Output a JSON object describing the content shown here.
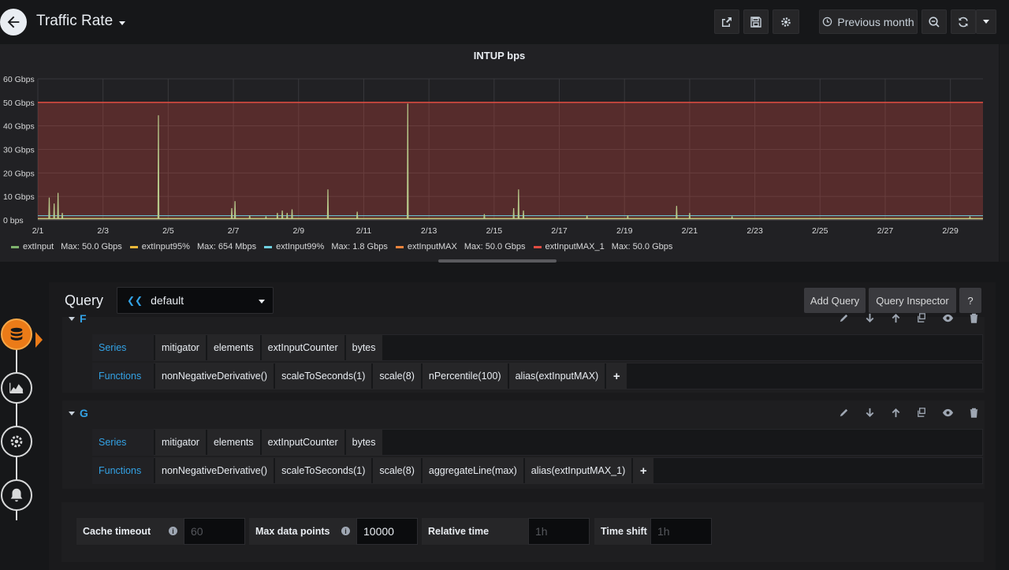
{
  "header": {
    "title": "Traffic Rate",
    "time_range_label": "Previous month"
  },
  "panel": {
    "title": "INTUP bps",
    "legend": [
      {
        "name": "extInput",
        "max": "Max: 50.0 Gbps",
        "color": "#7eb26d"
      },
      {
        "name": "extInput95%",
        "max": "Max: 654 Mbps",
        "color": "#eab839"
      },
      {
        "name": "extInput99%",
        "max": "Max: 1.8 Gbps",
        "color": "#6ed0e0"
      },
      {
        "name": "extInputMAX",
        "max": "Max: 50.0 Gbps",
        "color": "#ef843c"
      },
      {
        "name": "extInputMAX_1",
        "max": "Max: 50.0 Gbps",
        "color": "#e24d42"
      }
    ]
  },
  "chart_data": {
    "type": "line",
    "title": "INTUP bps",
    "y_ticks": [
      "60 Gbps",
      "50 Gbps",
      "40 Gbps",
      "30 Gbps",
      "20 Gbps",
      "10 Gbps",
      "0 bps"
    ],
    "x_ticks": [
      "2/1",
      "2/3",
      "2/5",
      "2/7",
      "2/9",
      "2/11",
      "2/13",
      "2/15",
      "2/17",
      "2/19",
      "2/21",
      "2/23",
      "2/25",
      "2/27",
      "2/29"
    ],
    "ylim": [
      0,
      60
    ],
    "x_range_days": [
      1,
      30
    ],
    "y_unit": "Gbps",
    "grid": true,
    "legend_position": "bottom",
    "fill_series": "extInputMAX_1",
    "series": [
      {
        "name": "extInputMAX_1",
        "color": "#e24d42",
        "constant": 50
      },
      {
        "name": "extInput95%",
        "color": "#eab839",
        "constant": 0.654
      },
      {
        "name": "extInput99%",
        "color": "#6ed0e0",
        "constant": 1.8
      },
      {
        "name": "extInput",
        "color": "#b7c98a",
        "spikes": [
          [
            1.35,
            9.5
          ],
          [
            1.5,
            7
          ],
          [
            1.62,
            11.5
          ],
          [
            1.75,
            3
          ],
          [
            4.7,
            44.5
          ],
          [
            6.95,
            5
          ],
          [
            7.05,
            8
          ],
          [
            7.5,
            2
          ],
          [
            8,
            1.5
          ],
          [
            8.35,
            3
          ],
          [
            8.5,
            4
          ],
          [
            8.65,
            3
          ],
          [
            8.8,
            4.5
          ],
          [
            9.9,
            13
          ],
          [
            10.8,
            3.5
          ],
          [
            12.35,
            49.5
          ],
          [
            14.7,
            2.5
          ],
          [
            15.6,
            5
          ],
          [
            15.75,
            13
          ],
          [
            15.9,
            4
          ],
          [
            17.85,
            2
          ],
          [
            19.1,
            2
          ],
          [
            20.6,
            6
          ],
          [
            21,
            3
          ],
          [
            22.3,
            1.5
          ],
          [
            29.6,
            1.5
          ]
        ]
      }
    ]
  },
  "query": {
    "label": "Query",
    "datasource": "default",
    "add_query": "Add Query",
    "inspector": "Query Inspector",
    "help": "?"
  },
  "targets": [
    {
      "letter": "F",
      "series_label": "Series",
      "series": [
        "mitigator",
        "elements",
        "extInputCounter",
        "bytes"
      ],
      "functions_label": "Functions",
      "functions": [
        "nonNegativeDerivative()",
        "scaleToSeconds(1)",
        "scale(8)",
        "nPercentile(100)",
        "alias(extInputMAX)"
      ]
    },
    {
      "letter": "G",
      "series_label": "Series",
      "series": [
        "mitigator",
        "elements",
        "extInputCounter",
        "bytes"
      ],
      "functions_label": "Functions",
      "functions": [
        "nonNegativeDerivative()",
        "scaleToSeconds(1)",
        "scale(8)",
        "aggregateLine(max)",
        "alias(extInputMAX_1)"
      ]
    }
  ],
  "options": {
    "cache_timeout_label": "Cache timeout",
    "cache_timeout_placeholder": "60",
    "max_points_label": "Max data points",
    "max_points_value": "10000",
    "relative_time_label": "Relative time",
    "relative_time_placeholder": "1h",
    "time_shift_label": "Time shift",
    "time_shift_placeholder": "1h",
    "info_glyph": "i"
  },
  "plus_glyph": "+"
}
